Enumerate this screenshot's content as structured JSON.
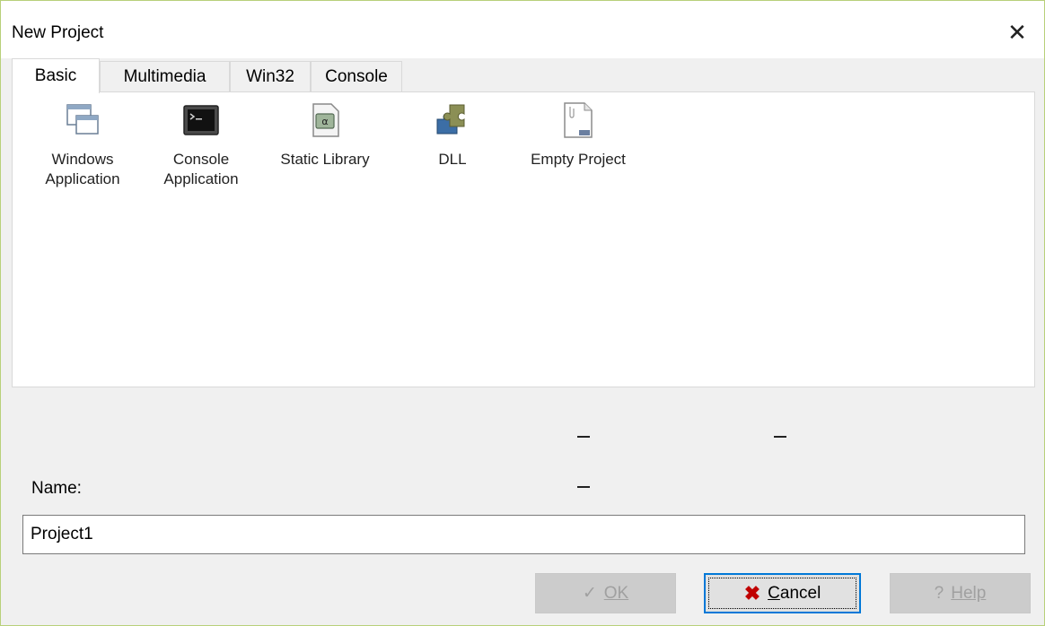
{
  "window": {
    "title": "New Project",
    "close_glyph": "✕"
  },
  "tabs": [
    {
      "label": "Basic",
      "active": true
    },
    {
      "label": "Multimedia",
      "active": false
    },
    {
      "label": "Win32",
      "active": false
    },
    {
      "label": "Console",
      "active": false
    }
  ],
  "templates": [
    {
      "label": "Windows Application",
      "icon": "window-app-icon"
    },
    {
      "label": "Console Application",
      "icon": "console-app-icon"
    },
    {
      "label": "Static Library",
      "icon": "static-library-icon"
    },
    {
      "label": "DLL",
      "icon": "dll-puzzle-icon"
    },
    {
      "label": "Empty Project",
      "icon": "empty-project-icon"
    }
  ],
  "name": {
    "label": "Name:",
    "value": "Project1"
  },
  "buttons": {
    "ok": {
      "label": "OK",
      "glyph": "✓",
      "enabled": false
    },
    "cancel": {
      "label": "Cancel",
      "glyph": "✖",
      "enabled": true
    },
    "help": {
      "label": "Help",
      "glyph": "?",
      "enabled": false
    }
  },
  "colors": {
    "cancel_x": "#c00000",
    "focus_border": "#0078d7",
    "window_border": "#b8d07a"
  }
}
